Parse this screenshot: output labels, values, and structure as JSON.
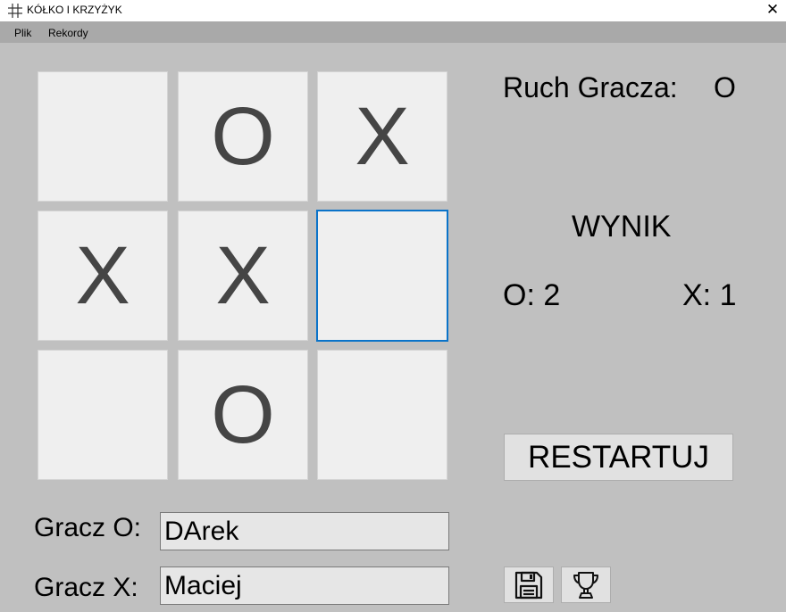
{
  "window": {
    "title": "KÓŁKO I KRZYŻYK",
    "close_glyph": "✕"
  },
  "menu": {
    "items": [
      {
        "label": "Plik"
      },
      {
        "label": "Rekordy"
      }
    ]
  },
  "board": {
    "cells": [
      {
        "value": ""
      },
      {
        "value": "O"
      },
      {
        "value": "X"
      },
      {
        "value": "X"
      },
      {
        "value": "X"
      },
      {
        "value": ""
      },
      {
        "value": ""
      },
      {
        "value": "O"
      },
      {
        "value": ""
      }
    ],
    "focused_index": 5
  },
  "turn": {
    "label": "Ruch Gracza:",
    "player": "O"
  },
  "score": {
    "title": "WYNIK",
    "o": "O: 2",
    "x": "X: 1"
  },
  "restart_label": "RESTARTUJ",
  "players": {
    "o_label": "Gracz O:",
    "o_name": "DArek",
    "x_label": "Gracz X:",
    "x_name": "Maciej"
  },
  "toolbar": {
    "save_icon": "floppy-disk-icon",
    "records_icon": "trophy-icon"
  },
  "colors": {
    "background": "#c0c0c0",
    "cell": "#efefef",
    "focus": "#0a73c9",
    "mark": "#454545",
    "menubar": "#a9a9a9"
  }
}
